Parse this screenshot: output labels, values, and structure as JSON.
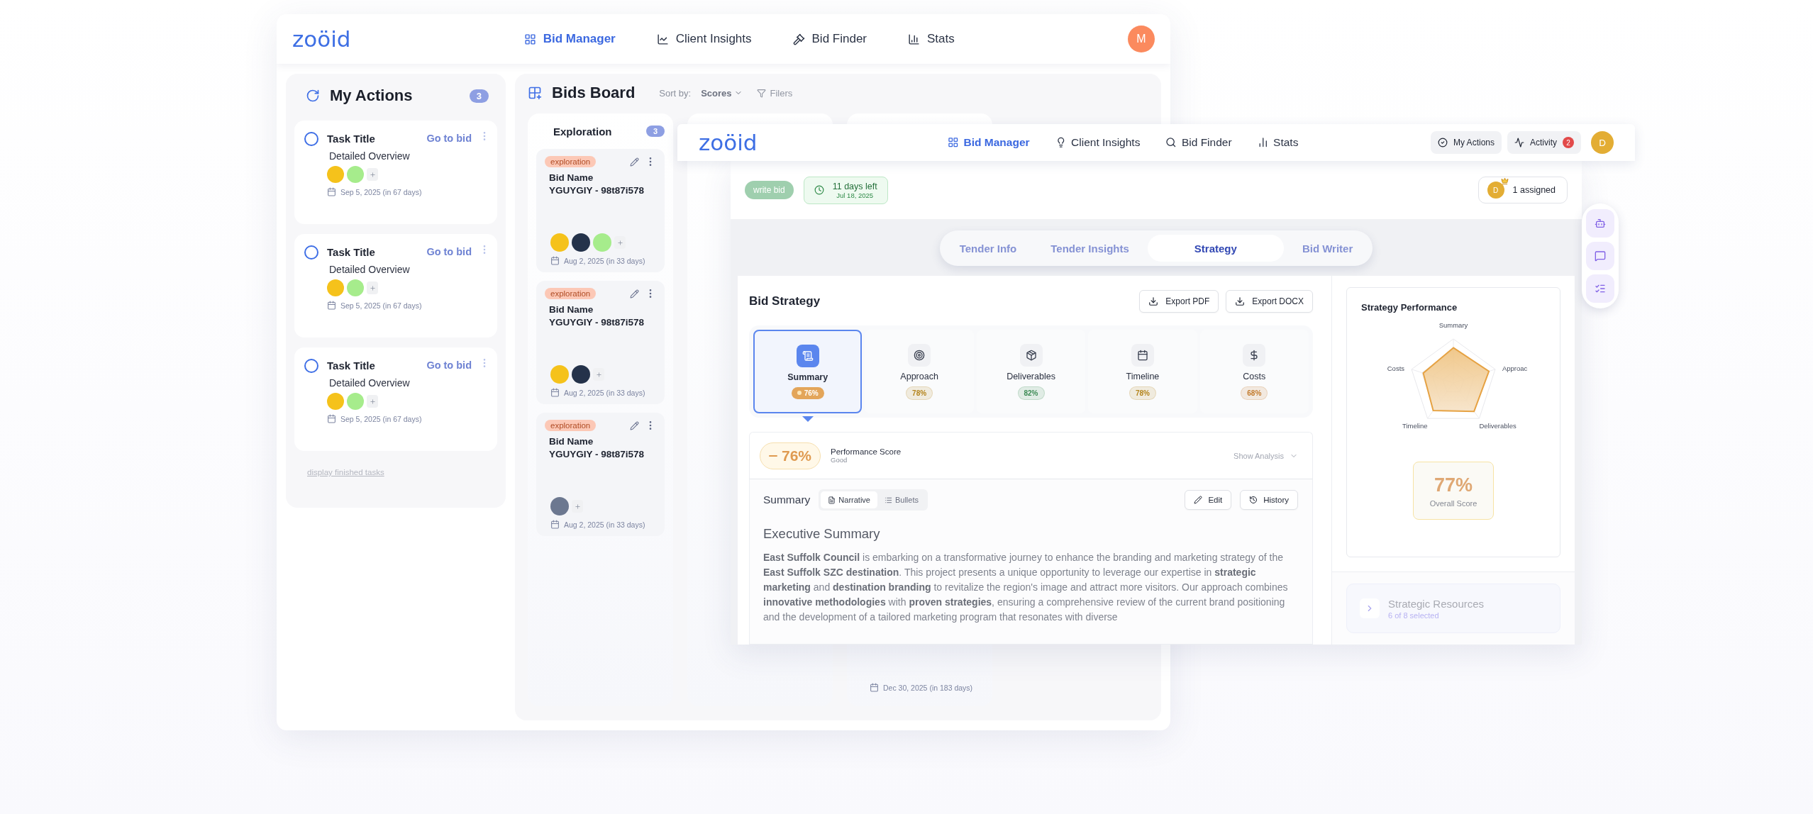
{
  "back_window": {
    "logo": "zoöid",
    "nav": [
      {
        "label": "Bid Manager",
        "selected": true
      },
      {
        "label": "Client Insights",
        "selected": false
      },
      {
        "label": "Bid Finder",
        "selected": false
      },
      {
        "label": "Stats",
        "selected": false
      }
    ],
    "avatar": "M",
    "my_actions": {
      "title": "My Actions",
      "count": "3",
      "tasks": [
        {
          "title": "Task Title",
          "link": "Go to bid",
          "overview": "Detailed Overview",
          "done": false,
          "avatars": [
            {
              "color": "#f5c21b"
            },
            {
              "color": "#a6ec8c"
            }
          ],
          "due": "Sep 5, 2025 (in 67 days)"
        },
        {
          "title": "Task Title",
          "link": "Go to bid",
          "overview": "Detailed Overview",
          "done": false,
          "avatars": [
            {
              "color": "#f5c21b"
            },
            {
              "color": "#a6ec8c"
            }
          ],
          "due": "Sep 5, 2025 (in 67 days)"
        },
        {
          "title": "Task Title",
          "link": "Go to bid",
          "overview": "Detailed Overview",
          "done": false,
          "avatars": [
            {
              "color": "#f5c21b"
            },
            {
              "color": "#a6ec8c"
            }
          ],
          "due": "Sep 5, 2025 (in 67 days)"
        }
      ],
      "footer_link": "display finished tasks"
    },
    "bids_board": {
      "title": "Bids Board",
      "sort_label": "Sort by:",
      "sort_value": "Scores",
      "filter": "Filers",
      "columns": [
        {
          "title": "Exploration",
          "count": "3",
          "cards": [
            {
              "tag": "exploration",
              "name": "Bid Name",
              "code": "YGUYGIY - 98t87i578",
              "avatars": [
                {
                  "color": "#f5c21b"
                },
                {
                  "color": "#24324a"
                },
                {
                  "color": "#a6ec8c"
                }
              ],
              "due": "Aug 2, 2025 (in 33 days)"
            },
            {
              "tag": "exploration",
              "name": "Bid Name",
              "code": "YGUYGIY - 98t87i578",
              "avatars": [
                {
                  "color": "#f5c21b"
                },
                {
                  "color": "#24324a"
                }
              ],
              "due": "Aug 2, 2025 (in 33 days)"
            },
            {
              "tag": "exploration",
              "name": "Bid Name",
              "code": "YGUYGIY - 98t87i578",
              "avatars": [
                {
                  "color": "#6c7890"
                }
              ],
              "due": "Aug 2, 2025 (in 33 days)"
            }
          ]
        },
        {},
        {
          "cards": [
            {
              "due": "Dec 30, 2025 (in 183 days)"
            }
          ]
        }
      ]
    }
  },
  "front_window": {
    "logo": "zoöid",
    "nav": [
      {
        "label": "Bid Manager",
        "selected": true
      },
      {
        "label": "Client Insights",
        "selected": false
      },
      {
        "label": "Bid Finder",
        "selected": false
      },
      {
        "label": "Stats",
        "selected": false
      }
    ],
    "actions": [
      {
        "label": "My Actions"
      },
      {
        "label": "Activity",
        "badge": "2"
      }
    ],
    "avatar": "D",
    "bid_status": {
      "stage": "write bid",
      "deadline": "11 days left",
      "date": "Jul 18, 2025",
      "assigned_avatar": "D",
      "assigned": "1 assigned"
    },
    "tabs": [
      {
        "label": "Tender Info",
        "selected": false
      },
      {
        "label": "Tender Insights",
        "selected": false
      },
      {
        "label": "Strategy",
        "selected": true
      },
      {
        "label": "Bid Writer",
        "selected": false
      }
    ],
    "strategy": {
      "title": "Bid Strategy",
      "exports": [
        "Export PDF",
        "Export DOCX"
      ],
      "sections": [
        {
          "name": "Summary",
          "score": "76%",
          "color": "#e3a55a",
          "selected": true
        },
        {
          "name": "Approach",
          "score": "78%",
          "color": "#b4841c",
          "selected": false
        },
        {
          "name": "Deliverables",
          "score": "82%",
          "color": "#3d8b55",
          "selected": false
        },
        {
          "name": "Timeline",
          "score": "78%",
          "color": "#b4841c",
          "selected": false
        },
        {
          "name": "Costs",
          "score": "68%",
          "color": "#c27a2c",
          "selected": false
        }
      ],
      "performance": {
        "score": "76%",
        "label": "Performance Score",
        "rating": "Good",
        "toggle": "Show Analysis"
      },
      "summary": {
        "title": "Summary",
        "views": [
          {
            "label": "Narrative",
            "selected": true
          },
          {
            "label": "Bullets",
            "selected": false
          }
        ],
        "actions": [
          "Edit",
          "History"
        ],
        "heading": "Executive Summary",
        "body": "**East Suffolk Council** is embarking on a transformative journey to enhance the branding and marketing strategy of the **East Suffolk SZC destination**. This project presents a unique opportunity to leverage our expertise in **strategic marketing** and **destination branding** to revitalize the region's image and attract more visitors. Our approach combines **innovative methodologies** with **proven strategies**, ensuring a comprehensive review of the current brand positioning and the development of a tailored marketing program that resonates with diverse"
      }
    },
    "performance_panel": {
      "title": "Strategy Performance",
      "axes": [
        "Summary",
        "Approac",
        "Deliverables",
        "Timeline",
        "Costs"
      ],
      "overall": "77%",
      "overall_label": "Overall Score"
    },
    "resources": {
      "title": "Strategic Resources",
      "selection": "6 of 8 selected"
    }
  }
}
